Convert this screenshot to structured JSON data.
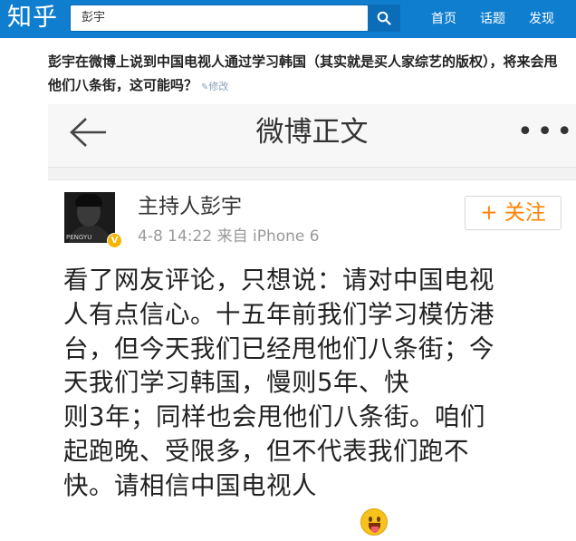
{
  "topbar": {
    "logo": "知乎",
    "search_value": "彭宇",
    "nav": [
      "首页",
      "话题",
      "发现"
    ]
  },
  "question": {
    "title": "彭宇在微博上说到中国电视人通过学习韩国（其实就是买人家综艺的版权），将来会甩他们八条街，这可能吗？",
    "edit_label": "修改"
  },
  "weibo": {
    "header_title": "微博正文",
    "more": "•••",
    "user_name": "主持人彭宇",
    "avatar_mark": "PENGYU",
    "verified_badge": "V",
    "meta": "4-8 14:22  来自 iPhone 6",
    "follow_label": "+ 关注",
    "content_lines": [
      "看了网友评论，只想说：请对中国电视",
      "人有点信心。十五年前我们学习模仿港",
      "台，但今天我们已经甩他们八条街；今",
      "天我们学习韩国，慢则5年、快",
      "则3年；同样也会甩他们八条街。咱们",
      "起跑晚、受限多，但不代表我们跑不",
      "快。请相信中国电视人"
    ]
  },
  "colors": {
    "zhihu_blue": "#0f7ecf",
    "follow_orange": "#ff8200"
  }
}
